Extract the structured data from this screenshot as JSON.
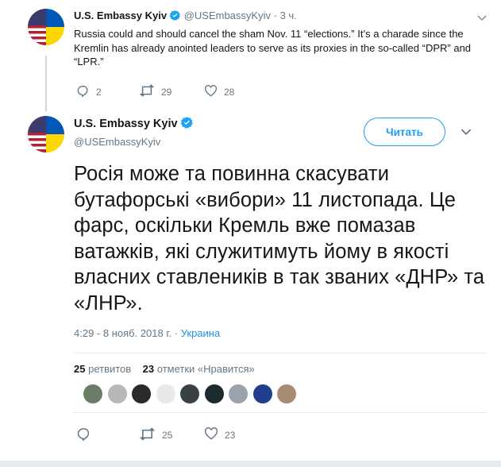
{
  "tweet1": {
    "name": "U.S. Embassy Kyiv",
    "handle": "@USEmbassyKyiv",
    "separator": "·",
    "time": "3 ч.",
    "text": "Russia could and should cancel the sham Nov. 11 “elections.” It’s a charade since the Kremlin has already anointed leaders to serve as its proxies in the so-called “DPR” and “LPR.”",
    "replies": "2",
    "retweets": "29",
    "likes": "28"
  },
  "tweet2": {
    "name": "U.S. Embassy Kyiv",
    "handle": "@USEmbassyKyiv",
    "follow_label": "Читать",
    "text": "Росія може та повинна скасувати бутафорські «вибори» 11 листопада. Це фарс, оскільки Кремль вже помазав ватажків, які служитимуть йому в якості власних ставлеників в так званих «ДНР» та «ЛНР».",
    "timestamp": "4:29 - 8 нояб. 2018 г.",
    "location": "Украина",
    "retweet_count": "25",
    "retweet_label": "ретвитов",
    "like_count": "23",
    "like_label": "отметки «Нравится»",
    "replies": "",
    "retweets": "25",
    "likes": "23"
  },
  "likers": [
    "#6a7d66",
    "#b8b8b8",
    "#2a2a2a",
    "#e9e9e9",
    "#3a4145",
    "#1c2a2e",
    "#9aa3ab",
    "#1f3f8a",
    "#a58b72"
  ],
  "colors": {
    "accent": "#1da1f2",
    "muted": "#657786",
    "verified": "#1da1f2"
  },
  "icons": {
    "verified": "verified-badge-icon",
    "reply": "reply-icon",
    "retweet": "retweet-icon",
    "like": "heart-icon",
    "more": "chevron-down-icon"
  }
}
